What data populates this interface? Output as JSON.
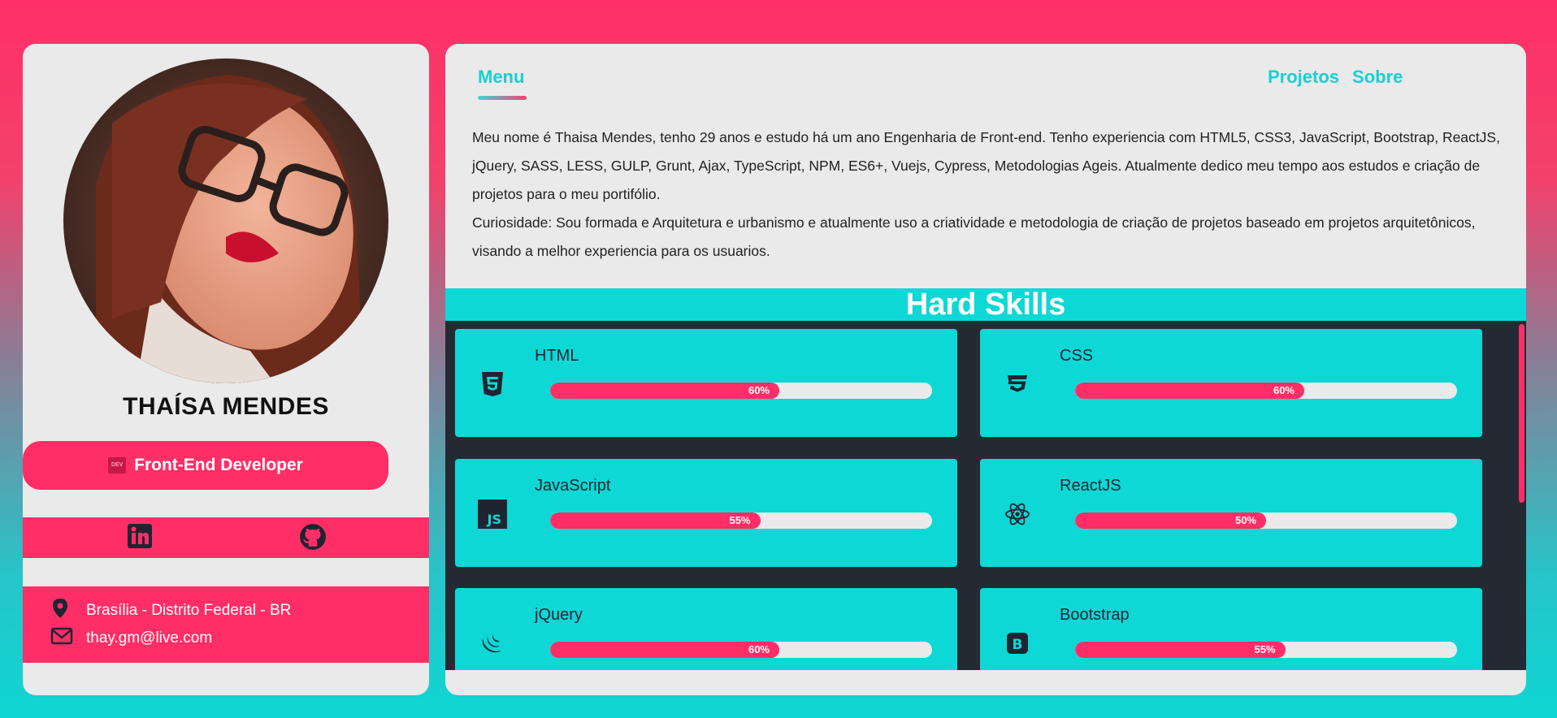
{
  "profile": {
    "name": "THAÍSA MENDES",
    "role": "Front-End Developer",
    "role_icon": "DEV",
    "location": "Brasília - Distrito Federal - BR",
    "email": "thay.gm@live.com"
  },
  "nav": {
    "menu_label": "Menu",
    "links": [
      "Projetos",
      "Sobre"
    ]
  },
  "about": {
    "paragraph1": "Meu nome é Thaisa Mendes, tenho 29 anos e estudo há um ano Engenharia de Front-end. Tenho experiencia com HTML5, CSS3, JavaScript, Bootstrap, ReactJS, jQuery, SASS, LESS, GULP, Grunt, Ajax, TypeScript, NPM, ES6+, Vuejs, Cypress, Metodologias Ageis. Atualmente dedico meu tempo aos estudos e criação de projetos para o meu portifólio.",
    "paragraph2": "Curiosidade: Sou formada e Arquitetura e urbanismo e atualmente uso a criatividade e metodologia de criação de projetos baseado em projetos arquitetônicos, visando a melhor experiencia para os usuarios."
  },
  "skills": {
    "title": "Hard Skills",
    "items": [
      {
        "label": "HTML",
        "percent": 60,
        "percent_label": "60%",
        "icon": "html5-icon"
      },
      {
        "label": "CSS",
        "percent": 60,
        "percent_label": "60%",
        "icon": "css3-icon"
      },
      {
        "label": "JavaScript",
        "percent": 55,
        "percent_label": "55%",
        "icon": "javascript-icon"
      },
      {
        "label": "ReactJS",
        "percent": 50,
        "percent_label": "50%",
        "icon": "react-icon"
      },
      {
        "label": "jQuery",
        "percent": 60,
        "percent_label": "60%",
        "icon": "jquery-icon"
      },
      {
        "label": "Bootstrap",
        "percent": 55,
        "percent_label": "55%",
        "icon": "bootstrap-icon"
      }
    ]
  },
  "colors": {
    "accent_pink": "#ff2e66",
    "accent_cyan": "#0dd8d6",
    "dark": "#242a33",
    "card": "#eaeaea"
  }
}
